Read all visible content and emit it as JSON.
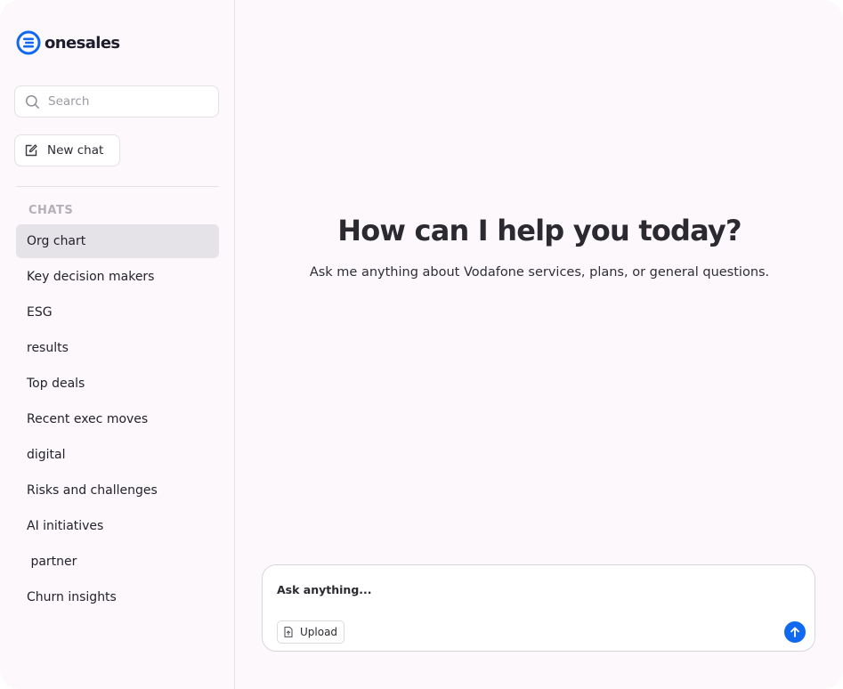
{
  "brand": {
    "name": "onesales",
    "accent_color": "#1169f0"
  },
  "sidebar": {
    "search": {
      "placeholder": "Search",
      "icon": "search-icon"
    },
    "new_chat": {
      "label": "New chat",
      "icon": "edit-square-icon"
    },
    "section_label": "CHATS",
    "items": [
      {
        "label": "Org chart",
        "active": true
      },
      {
        "label": "Key decision makers"
      },
      {
        "label": "ESG"
      },
      {
        "label": "results"
      },
      {
        "label": "Top deals"
      },
      {
        "label": "Recent exec moves"
      },
      {
        "label": "digital"
      },
      {
        "label": "Risks and challenges"
      },
      {
        "label": "AI initiatives"
      },
      {
        "label": " partner"
      },
      {
        "label": "Churn insights"
      }
    ]
  },
  "main": {
    "title": "How can I help you today?",
    "subtitle": "Ask me anything about Vodafone services, plans, or general questions.",
    "composer": {
      "placeholder": "Ask anything...",
      "upload_label": "Upload",
      "upload_icon": "file-upload-icon",
      "send_icon": "arrow-up-icon"
    }
  }
}
